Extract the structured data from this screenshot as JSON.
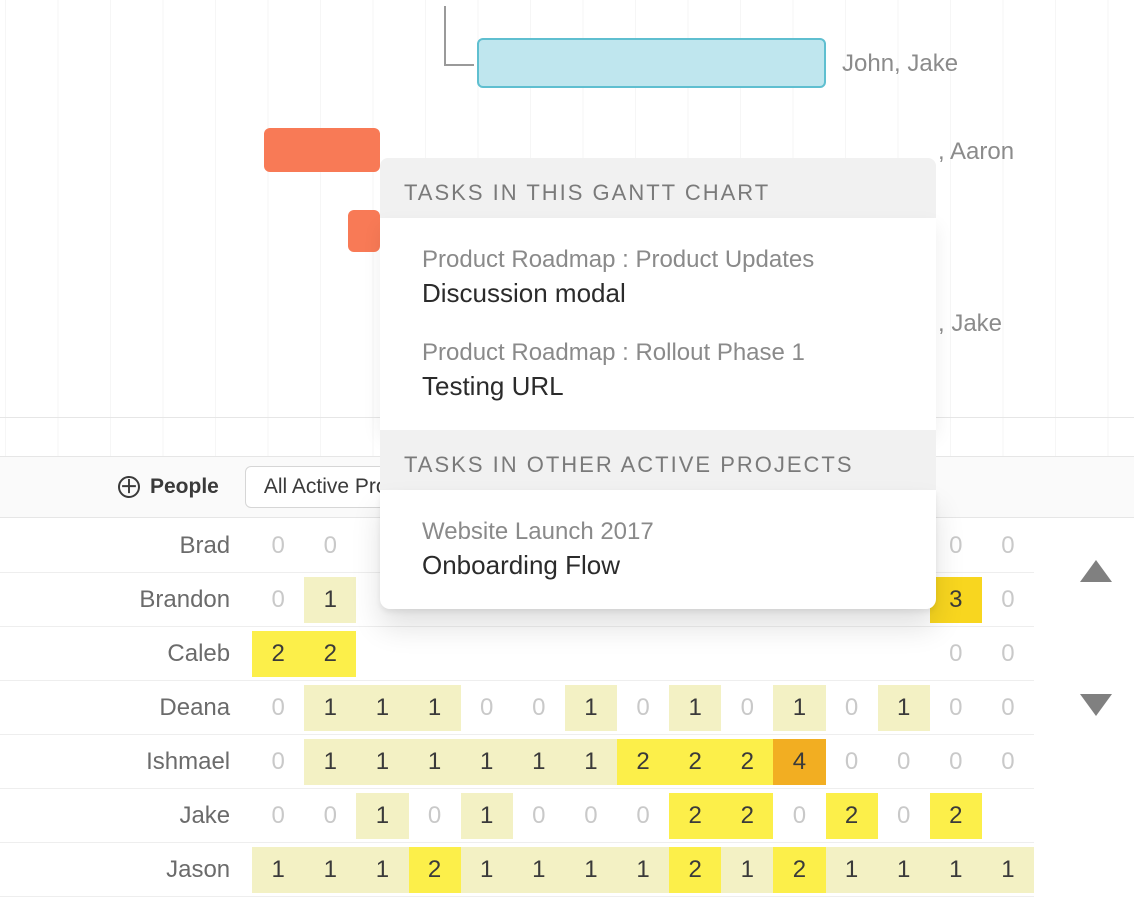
{
  "gantt": {
    "assignees_bar1": "John, Jake",
    "assignees_bar2": ", Aaron",
    "assignees_bar3": ", Jake"
  },
  "toolbar": {
    "people_btn": "People",
    "filter_label": "All Active Projects"
  },
  "popover": {
    "section1_header": "TASKS IN THIS GANTT CHART",
    "items1": [
      {
        "crumb": "Product Roadmap : Product Updates",
        "title": "Discussion modal"
      },
      {
        "crumb": "Product Roadmap : Rollout Phase 1",
        "title": "Testing URL"
      }
    ],
    "section2_header": "TASKS IN OTHER ACTIVE PROJECTS",
    "items2": [
      {
        "crumb": "Website Launch 2017",
        "title": "Onboarding Flow"
      }
    ]
  },
  "grid": {
    "rows": [
      {
        "name": "Brad",
        "cells": [
          0,
          0,
          null,
          null,
          null,
          null,
          null,
          null,
          null,
          null,
          null,
          null,
          null,
          0,
          0
        ]
      },
      {
        "name": "Brandon",
        "cells": [
          0,
          1,
          null,
          null,
          null,
          null,
          null,
          null,
          null,
          null,
          null,
          null,
          null,
          3,
          0
        ]
      },
      {
        "name": "Caleb",
        "cells": [
          2,
          2,
          null,
          null,
          null,
          null,
          null,
          null,
          null,
          null,
          null,
          null,
          null,
          0,
          0
        ]
      },
      {
        "name": "Deana",
        "cells": [
          0,
          1,
          1,
          1,
          0,
          0,
          1,
          0,
          1,
          0,
          1,
          0,
          1,
          0,
          0
        ]
      },
      {
        "name": "Ishmael",
        "cells": [
          0,
          1,
          1,
          1,
          1,
          1,
          1,
          2,
          2,
          2,
          4,
          0,
          0,
          0,
          0
        ]
      },
      {
        "name": "Jake",
        "cells": [
          0,
          0,
          1,
          0,
          1,
          0,
          0,
          0,
          2,
          2,
          0,
          2,
          0,
          2,
          null
        ]
      },
      {
        "name": "Jason",
        "cells": [
          1,
          1,
          1,
          2,
          1,
          1,
          1,
          1,
          2,
          1,
          2,
          1,
          1,
          1,
          1
        ]
      }
    ]
  }
}
